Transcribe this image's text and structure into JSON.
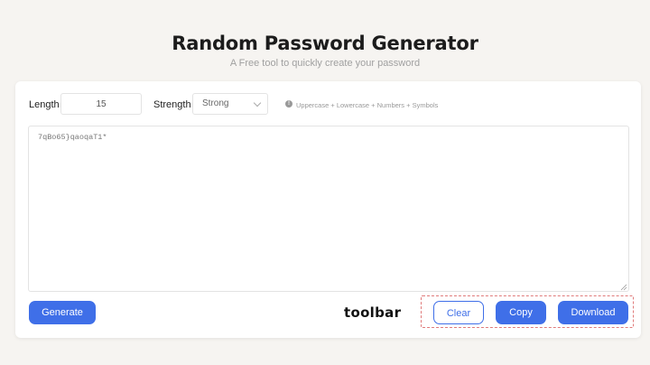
{
  "header": {
    "title": "Random Password Generator",
    "subtitle": "A Free tool to quickly create your password"
  },
  "options": {
    "length_label": "Length",
    "length_value": "15",
    "strength_label": "Strength",
    "strength_value": "Strong",
    "charset_info": "Uppercase + Lowercase + Numbers + Symbols",
    "info_icon": "info-icon"
  },
  "output": {
    "password": "7qBo65}qaoqaT1*"
  },
  "actions": {
    "generate_label": "Generate",
    "toolbar_label": "toolbar",
    "clear_label": "Clear",
    "copy_label": "Copy",
    "download_label": "Download"
  },
  "colors": {
    "accent": "#3f6fe8",
    "toolbar_outline": "#e07b7b",
    "background": "#f6f4f1"
  }
}
